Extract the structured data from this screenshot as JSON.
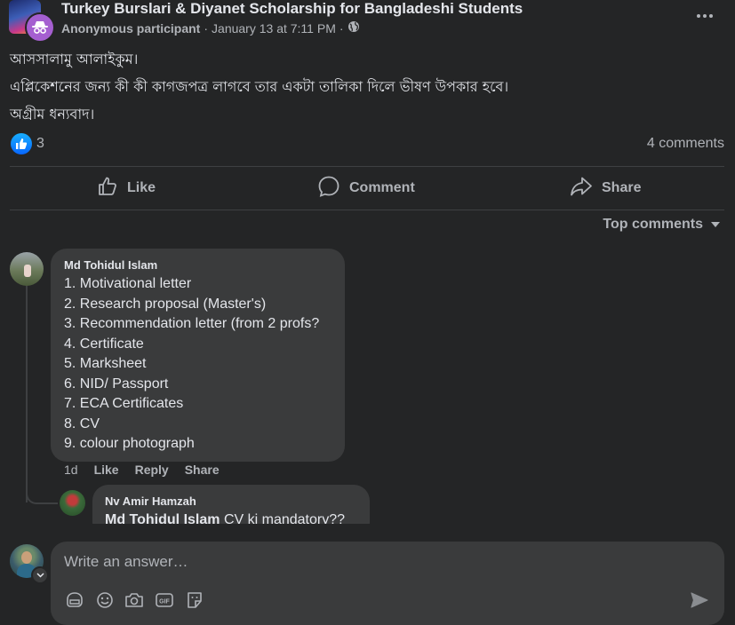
{
  "post": {
    "group_name": "Turkey Burslari & Diyanet Scholarship for Bangladeshi Students",
    "author": "Anonymous participant",
    "separator": "·",
    "timestamp": "January 13 at 7:11 PM",
    "separator2": "·",
    "privacy_icon": "globe-icon",
    "body": [
      "আসসালামু আলাইকুম।",
      "এপ্লিকেশনের জন্য কী কী কাগজপত্র লাগবে তার একটা তালিকা দিলে ভীষণ উপকার হবে।",
      "অগ্রীম ধন্যবাদ।"
    ]
  },
  "reactions": {
    "like_count": "3",
    "comments_count": "4 comments"
  },
  "actions": {
    "like": "Like",
    "comment": "Comment",
    "share": "Share"
  },
  "sort": {
    "label": "Top comments"
  },
  "comments": [
    {
      "author": "Md Tohidul Islam",
      "lines": [
        "1. Motivational letter",
        "2. Research proposal (Master's)",
        "3. Recommendation letter (from 2 profs?",
        "4. Certificate",
        "5. Marksheet",
        "6. NID/ Passport",
        "7. ECA Certificates",
        "8. CV",
        "9. colour photograph"
      ],
      "time": "1d",
      "like": "Like",
      "reply": "Reply",
      "share": "Share"
    }
  ],
  "reply": {
    "author": "Nv Amir Hamzah",
    "mention": "Md Tohidul Islam",
    "text": "CV ki mandatory??"
  },
  "composer": {
    "placeholder": "Write an answer…"
  },
  "colors": {
    "accent": "#0866ff",
    "background": "#242526",
    "bubble": "#3a3b3c",
    "anon_badge": "#a55fd0"
  }
}
